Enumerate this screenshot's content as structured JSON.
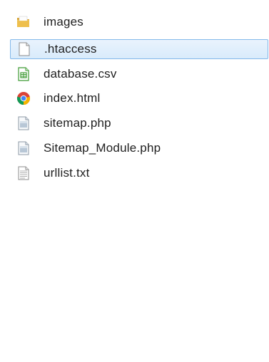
{
  "files": [
    {
      "name": "images",
      "icon": "folder-icon",
      "selected": false
    },
    {
      "name": ".htaccess",
      "icon": "blank-file-icon",
      "selected": true
    },
    {
      "name": "database.csv",
      "icon": "spreadsheet-icon",
      "selected": false
    },
    {
      "name": "index.html",
      "icon": "chrome-icon",
      "selected": false
    },
    {
      "name": "sitemap.php",
      "icon": "php-file-icon",
      "selected": false
    },
    {
      "name": "Sitemap_Module.php",
      "icon": "php-file-icon",
      "selected": false
    },
    {
      "name": "urllist.txt",
      "icon": "text-file-icon",
      "selected": false
    }
  ],
  "colors": {
    "selection_fill": "#dcecfc",
    "selection_border": "#84b9ea",
    "folder": "#e8b84a",
    "spreadsheet": "#3f9b35",
    "text": "#1e1e1e"
  }
}
